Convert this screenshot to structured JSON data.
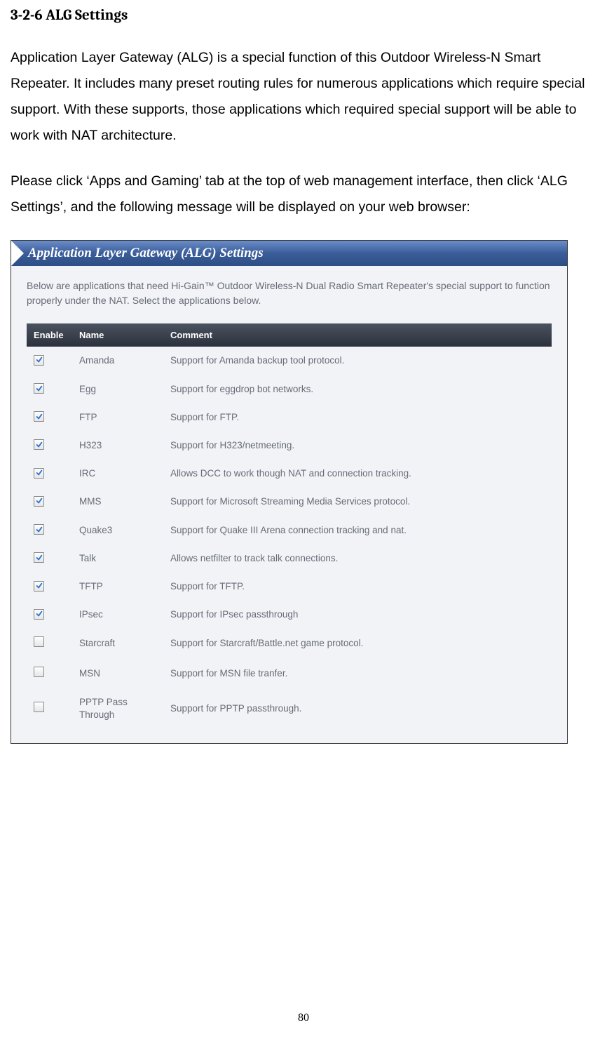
{
  "section_heading": "3-2-6 ALG Settings",
  "paragraph1": "Application Layer Gateway (ALG) is a special function of this Outdoor Wireless-N Smart Repeater. It includes many preset routing rules for numerous applications which require special support. With these supports, those applications which required special support will be able to work with NAT architecture.",
  "paragraph2": "Please click ‘Apps and Gaming’ tab at the top of web management interface, then click ‘ALG Settings’, and the following message will be displayed on your web browser:",
  "page_number": "80",
  "screenshot": {
    "banner_title": "Application Layer Gateway (ALG) Settings",
    "description": "Below are applications that need Hi-Gain™ Outdoor Wireless-N Dual Radio Smart Repeater's special support to function properly under the NAT. Select the applications below.",
    "headers": {
      "enable": "Enable",
      "name": "Name",
      "comment": "Comment"
    },
    "rows": [
      {
        "checked": true,
        "name": "Amanda",
        "comment": "Support for Amanda backup tool protocol."
      },
      {
        "checked": true,
        "name": "Egg",
        "comment": "Support for eggdrop bot networks."
      },
      {
        "checked": true,
        "name": "FTP",
        "comment": "Support for FTP."
      },
      {
        "checked": true,
        "name": "H323",
        "comment": "Support for H323/netmeeting."
      },
      {
        "checked": true,
        "name": "IRC",
        "comment": "Allows DCC to work though NAT and connection tracking."
      },
      {
        "checked": true,
        "name": "MMS",
        "comment": "Support for Microsoft Streaming Media Services protocol."
      },
      {
        "checked": true,
        "name": "Quake3",
        "comment": "Support for Quake III Arena connection tracking and nat."
      },
      {
        "checked": true,
        "name": "Talk",
        "comment": "Allows netfilter to track talk connections."
      },
      {
        "checked": true,
        "name": "TFTP",
        "comment": "Support for TFTP."
      },
      {
        "checked": true,
        "name": "IPsec",
        "comment": "Support for IPsec passthrough"
      },
      {
        "checked": false,
        "name": "Starcraft",
        "comment": "Support for Starcraft/Battle.net game protocol."
      },
      {
        "checked": false,
        "name": "MSN",
        "comment": "Support for MSN file tranfer."
      },
      {
        "checked": false,
        "name": "PPTP Pass Through",
        "comment": "Support for PPTP passthrough."
      }
    ]
  }
}
